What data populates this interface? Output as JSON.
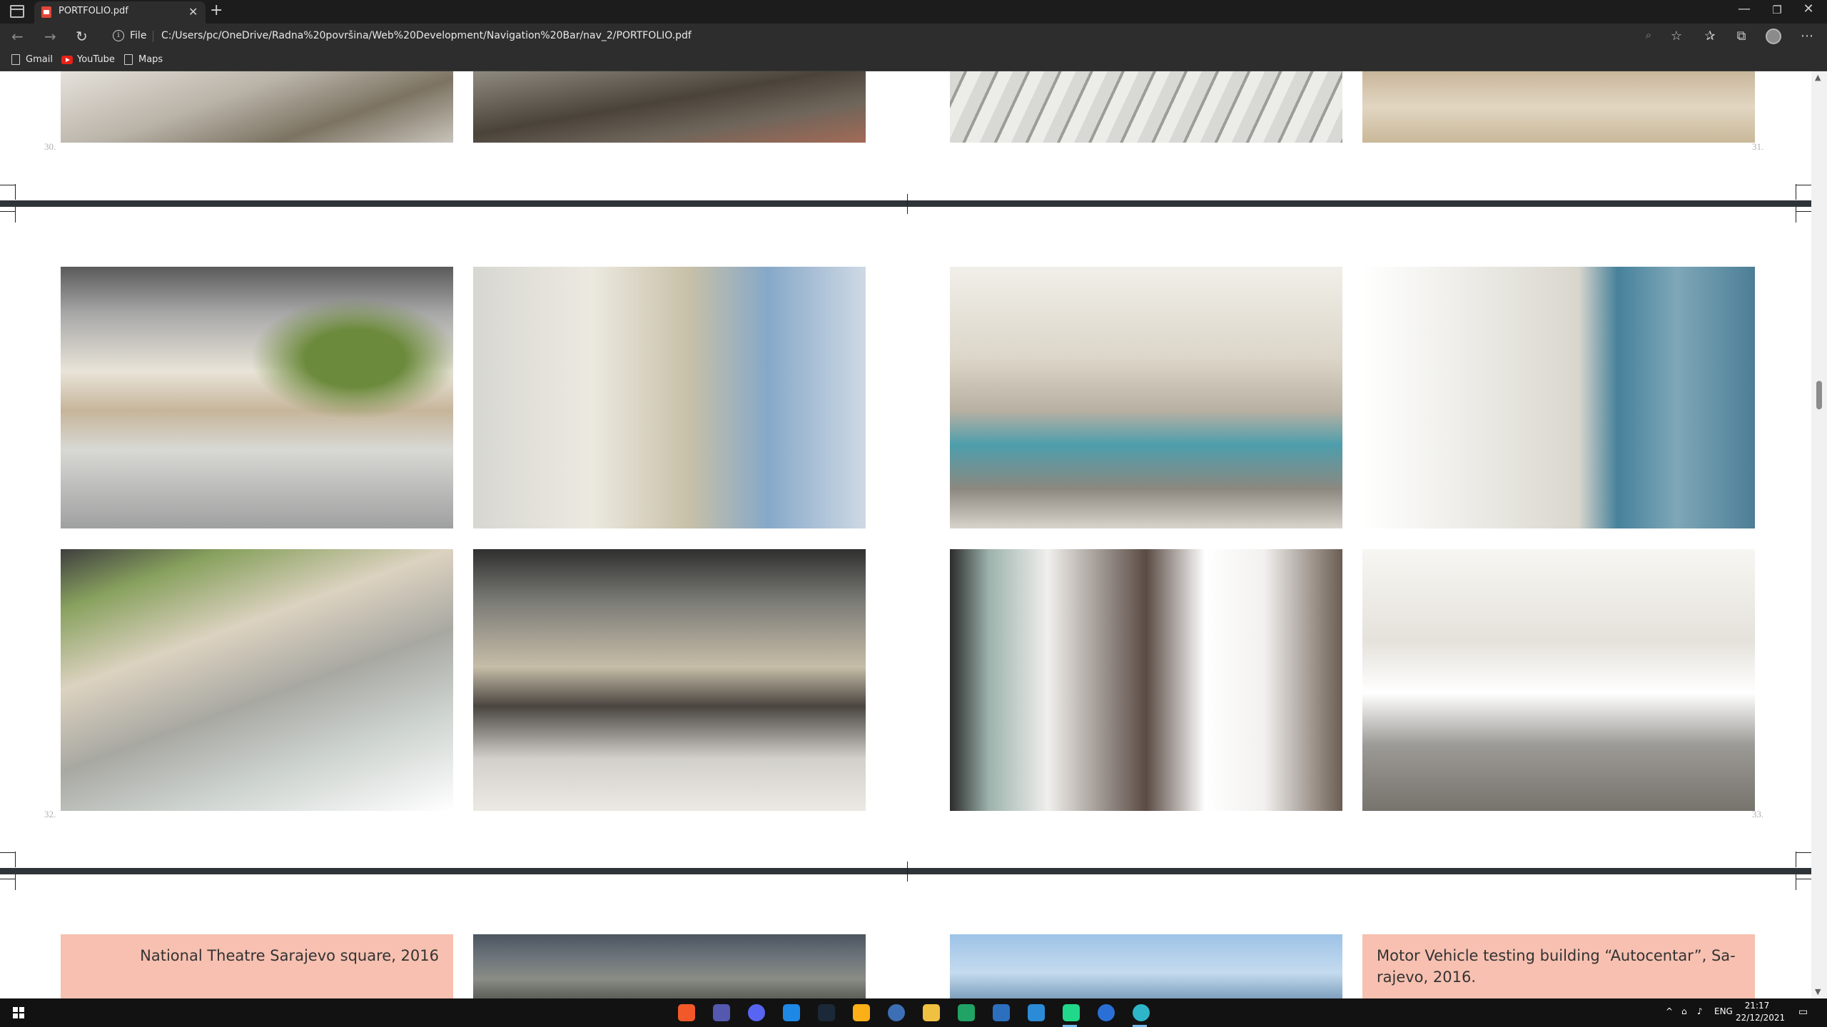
{
  "browser": {
    "tab_title": "PORTFOLIO.pdf",
    "file_label": "File",
    "url": "C:/Users/pc/OneDrive/Radna%20površina/Web%20Development/Navigation%20Bar/nav_2/PORTFOLIO.pdf"
  },
  "bookmarks": [
    {
      "label": "Gmail",
      "icon": "doc-icon"
    },
    {
      "label": "YouTube",
      "icon": "youtube-icon"
    },
    {
      "label": "Maps",
      "icon": "doc-icon"
    }
  ],
  "pdf": {
    "pages": [
      {
        "number": "30."
      },
      {
        "number": "31."
      },
      {
        "number": "32."
      },
      {
        "number": "33."
      }
    ],
    "captions": {
      "theatre": "National Theatre Sarajevo square, 2016",
      "autocentar": "Motor Vehicle testing building “Autocentar”, Sa-rajevo, 2016."
    }
  },
  "taskbar": {
    "language": "ENG",
    "time": "21:17",
    "date": "22/12/2021"
  },
  "colors": {
    "accent_salmon": "#f7c0b0",
    "page_gap": "#2f3438",
    "taskbar_active": "#76b9ed"
  }
}
